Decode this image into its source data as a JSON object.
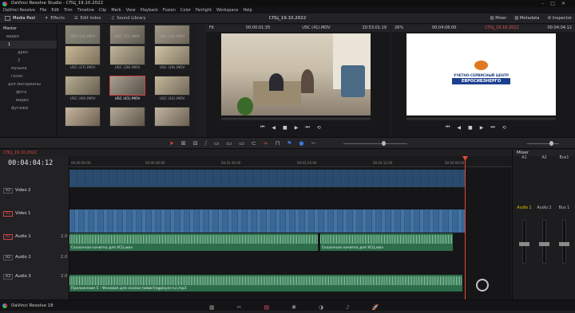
{
  "app": {
    "window_title": "DaVinci Resolve Studio - СПЦ_19.10.2022",
    "menu": [
      "DaVinci Resolve",
      "File",
      "Edit",
      "Trim",
      "Timeline",
      "Clip",
      "Mark",
      "View",
      "Playback",
      "Fusion",
      "Color",
      "Fairlight",
      "Workspace",
      "Help"
    ],
    "project_title": "СПЦ_19.10.2022",
    "status_app": "DaVinci Resolve 18"
  },
  "toolbar": {
    "media_pool": "Media Pool",
    "effects": "Effects",
    "edit_index": "Edit Index",
    "sound_library": "Sound Library",
    "mixer": "Mixer",
    "metadata": "Metadata",
    "inspector": "Inspector"
  },
  "media_pool": {
    "tree": [
      "Master",
      "видео",
      "1",
      "дрон",
      "2",
      "музыка",
      "голос",
      "доп материалы",
      "фото",
      "видео",
      "футажи"
    ],
    "clips": [
      "USC (20).MOV",
      "USC (21).MOV",
      "USC (22).MOV",
      "USC (27).MOV",
      "USC (28).MOV",
      "USC (29).MOV",
      "USC (40).MOV",
      "USC (41).MOV",
      "USC (42).MOV",
      "",
      "",
      ""
    ]
  },
  "source_viewer": {
    "zoom": "Fit",
    "tc_in": "00:00:01:35",
    "clip_name": "USC (41).MOV",
    "tc_out": "20:53:01:19"
  },
  "timeline_viewer": {
    "zoom": "26%",
    "tc_in": "00:04:06:00",
    "name": "СПЦ_19.10.2022",
    "tc_out": "00:04:04:12",
    "logo_line1": "УЧЕТНО-СЕРВИСНЫЙ ЦЕНТР",
    "logo_line2": "ЕВРОСИБЭНЕРГО"
  },
  "timeline": {
    "name": "СПЦ_19.10.2022",
    "timecode": "00:04:04:12",
    "ruler": [
      "00:00:00:00",
      "00:00:48:00",
      "00:01:36:00",
      "00:02:24:00",
      "00:03:12:00",
      "00:04:00:00"
    ],
    "tracks": [
      {
        "id": "V2",
        "name": "Video 2"
      },
      {
        "id": "V1",
        "name": "Video 1"
      },
      {
        "id": "A1",
        "name": "Audio 1",
        "vol": "2.0"
      },
      {
        "id": "A2",
        "name": "Audio 2",
        "vol": "2.0"
      },
      {
        "id": "A3",
        "name": "Audio 3",
        "vol": "2.0"
      }
    ],
    "audio_clips": {
      "a1_1": "Сказочная начитка для УСЦ.wav",
      "a1_2": "Сказочная начитка для УСЦ.wav",
      "a3": "Приложение 5 - Фоновая для сказки (www.frogplayer.ru).mp3"
    }
  },
  "mixer": {
    "title": "Mixer",
    "channels": [
      "A1",
      "A2",
      "Bus1"
    ],
    "ch_labels": [
      "Audio 1",
      "Audio 2",
      "Bus 1"
    ]
  },
  "colors": {
    "accent": "#e24a3b",
    "audio": "#2d6d4b",
    "video": "#3a6796"
  }
}
